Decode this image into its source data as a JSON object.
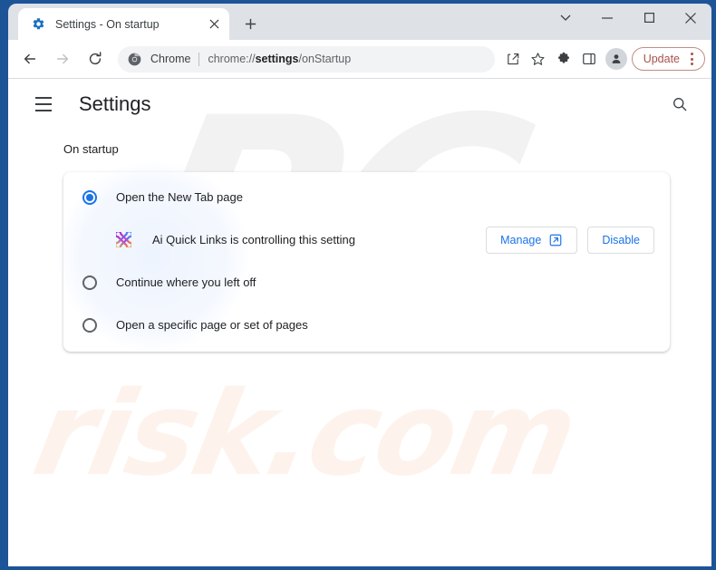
{
  "window": {
    "controls": {
      "tab_search": "tab-search-chevron",
      "minimize": "minimize",
      "maximize": "maximize",
      "close": "close"
    }
  },
  "tabstrip": {
    "active_tab": {
      "title": "Settings - On startup",
      "favicon": "settings-gear-icon",
      "close_label": "×"
    },
    "new_tab_label": "+"
  },
  "toolbar": {
    "back": "back-arrow",
    "forward": "forward-arrow",
    "reload": "reload",
    "omnibox": {
      "brand_icon": "chrome-logo",
      "brand_label": "Chrome",
      "url_prefix": "chrome://",
      "url_bold": "settings",
      "url_suffix": "/onStartup"
    },
    "share_icon": "share-icon",
    "bookmark_icon": "bookmark-star-icon",
    "extensions_icon": "extensions-puzzle-icon",
    "side_panel_icon": "side-panel-icon",
    "avatar_icon": "profile-avatar-icon",
    "update_label": "Update",
    "update_accent": "#a8524a",
    "menu_icon": "three-dot-menu-icon"
  },
  "settings": {
    "menu_icon": "hamburger-menu-icon",
    "title": "Settings",
    "search_icon": "search-icon",
    "section_title": "On startup",
    "accent_color": "#1a73e8",
    "options": [
      {
        "label": "Open the New Tab page",
        "selected": true
      },
      {
        "label": "Continue where you left off",
        "selected": false
      },
      {
        "label": "Open a specific page or set of pages",
        "selected": false
      }
    ],
    "extension_notice": {
      "icon": "ai-quick-links-extension-icon",
      "text": "Ai Quick Links is controlling this setting",
      "manage_label": "Manage",
      "manage_icon": "external-link-icon",
      "disable_label": "Disable"
    }
  },
  "watermarks": {
    "logo": "PC",
    "domain": "risk.com"
  }
}
